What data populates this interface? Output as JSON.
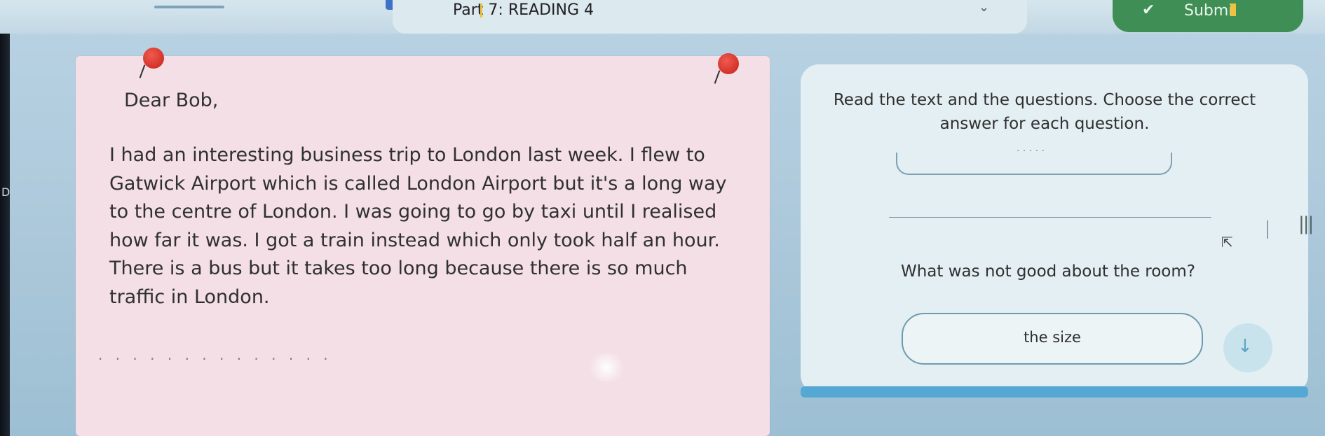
{
  "header": {
    "title": "Part 7: READING 4",
    "submit_label": "Submi",
    "chevron": "⌄"
  },
  "letter": {
    "greeting": "Dear Bob,",
    "body": "I had an interesting business trip to London last week. I flew to Gatwick Airport which is called London Airport but it's a long way to the centre of London. I was going to go by taxi until I realised how far it was. I got a train instead which only took half an hour. There is a bus but it takes too long because there is so much traffic in London."
  },
  "question_panel": {
    "instructions": "Read the text and the questions. Choose the correct answer for each question.",
    "question": "What was not good about the room?",
    "option": "the size"
  },
  "colors": {
    "submit_green": "#3f8e55",
    "pin_red": "#d3322a",
    "progress_blue": "#55a8d3"
  },
  "icons": {
    "submit": "check-icon",
    "next": "down-arrow-icon",
    "pins": "pushpin-icon"
  }
}
